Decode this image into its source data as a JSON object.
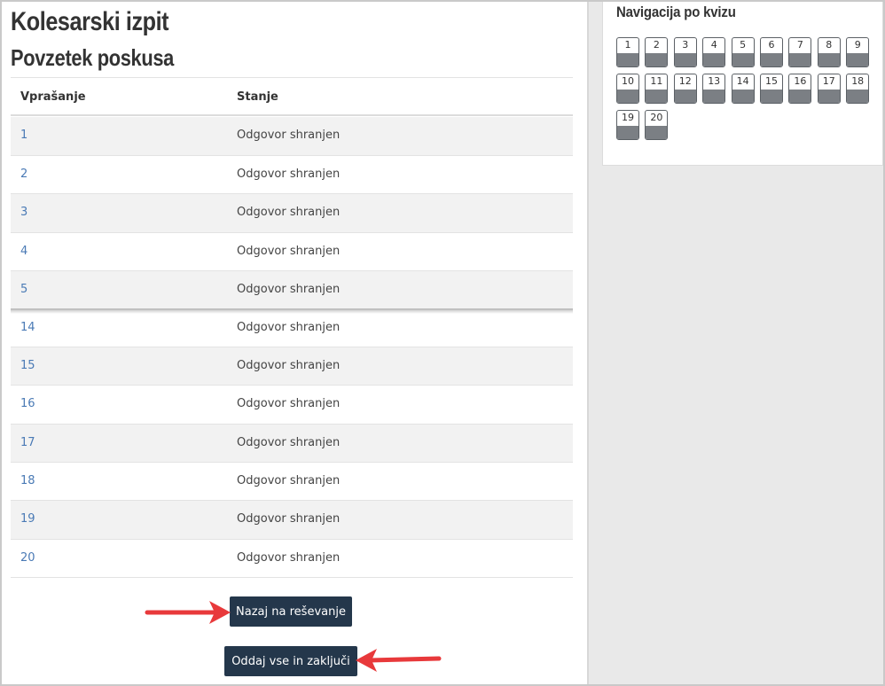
{
  "quiz": {
    "title": "Kolesarski izpit",
    "subtitle": "Povzetek poskusa"
  },
  "table": {
    "headers": {
      "question": "Vprašanje",
      "status": "Stanje"
    },
    "rows": [
      {
        "q": "1",
        "status": "Odgovor shranjen"
      },
      {
        "q": "2",
        "status": "Odgovor shranjen"
      },
      {
        "q": "3",
        "status": "Odgovor shranjen"
      },
      {
        "q": "4",
        "status": "Odgovor shranjen"
      },
      {
        "q": "5",
        "status": "Odgovor shranjen"
      },
      {
        "q": "14",
        "status": "Odgovor shranjen"
      },
      {
        "q": "15",
        "status": "Odgovor shranjen"
      },
      {
        "q": "16",
        "status": "Odgovor shranjen"
      },
      {
        "q": "17",
        "status": "Odgovor shranjen"
      },
      {
        "q": "18",
        "status": "Odgovor shranjen"
      },
      {
        "q": "19",
        "status": "Odgovor shranjen"
      },
      {
        "q": "20",
        "status": "Odgovor shranjen"
      }
    ]
  },
  "buttons": {
    "back_label": "Nazaj na reševanje",
    "submit_label": "Oddaj vse in zaključi"
  },
  "nav": {
    "title": "Navigacija po kvizu",
    "questions": [
      "1",
      "2",
      "3",
      "4",
      "5",
      "6",
      "7",
      "8",
      "9",
      "10",
      "11",
      "12",
      "13",
      "14",
      "15",
      "16",
      "17",
      "18",
      "19",
      "20"
    ]
  },
  "colors": {
    "button_bg": "#24374b",
    "link": "#4a7ab5",
    "annotation_arrow": "#e8393b"
  },
  "icons": {
    "annotation": "red-arrow-icon"
  }
}
